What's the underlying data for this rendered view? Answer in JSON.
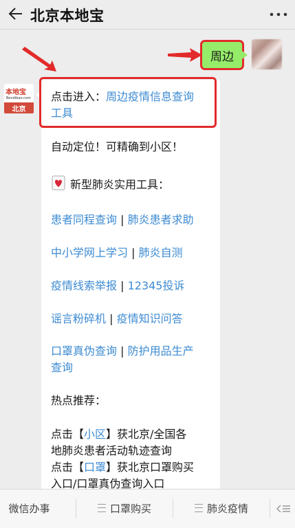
{
  "header": {
    "title": "北京本地宝",
    "back_icon": "back-arrow-icon",
    "more_icon": "more-dots-icon"
  },
  "right_message": {
    "text": "周边",
    "bubble_color": "#95ec69"
  },
  "left_avatar": {
    "brand": "本地宝",
    "site": "Bendibao.com",
    "city": "北京"
  },
  "message": {
    "intro_prefix": "点击进入：",
    "intro_link_line1": "周边疫情信息查询",
    "intro_link_line2": "工具",
    "auto_locate": "自动定位！可精确到小区！",
    "tools_heading": "新型肺炎实用工具：",
    "tools": [
      {
        "a": "患者同程查询",
        "sep": " | ",
        "b": "肺炎患者求助"
      },
      {
        "a": "中小学网上学习",
        "sep": " | ",
        "b": "肺炎自测"
      },
      {
        "a": "疫情线索举报",
        "sep": " | ",
        "b": "12345投诉"
      },
      {
        "a": "谣言粉碎机",
        "sep": " | ",
        "b": "疫情知识问答"
      },
      {
        "a": "口罩真伪查询",
        "sep": " | ",
        "b": "防护用品生产",
        "b2": "查询"
      }
    ],
    "hot_heading": "热点推荐：",
    "hot1_pre": "点击【",
    "hot1_link": "小区",
    "hot1_post": "】获北京/全国各",
    "hot1_line2": "地肺炎患者活动轨迹查询",
    "hot2_pre": "点击【",
    "hot2_link": "口罩",
    "hot2_post": "】获北京口罩购买",
    "hot2_line2": "入口/口罩真伪查询入口"
  },
  "bottom_menu": {
    "items": [
      "微信办事",
      "口罩购买",
      "肺炎疫情"
    ]
  },
  "colors": {
    "link": "#3d8bd2",
    "annotation_red": "#e22a2a",
    "background": "#ededed"
  }
}
